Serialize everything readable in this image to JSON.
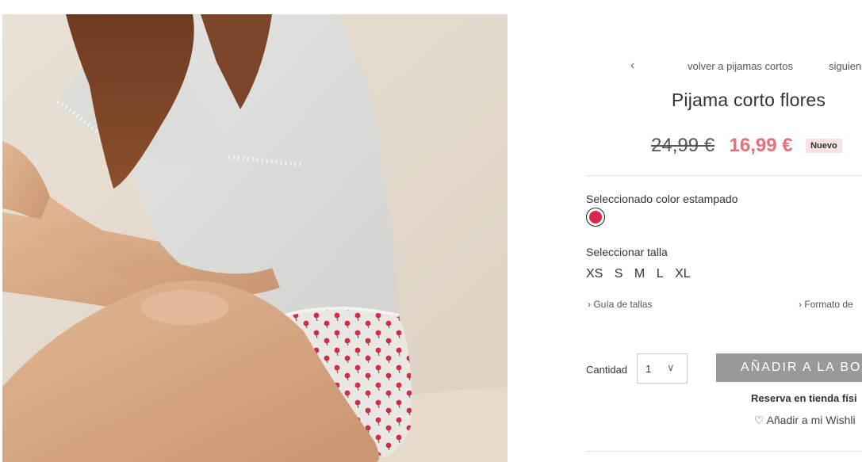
{
  "navigation": {
    "prev_icon": "chevron-left-icon",
    "back_label": "volver a pijamas cortos",
    "next_label": "siguien"
  },
  "product": {
    "title": "Pijama corto flores",
    "old_price": "24,99 €",
    "new_price": "16,99 €",
    "badge": "Nuevo"
  },
  "color": {
    "label": "Seleccionado color estampado",
    "swatch_color": "#d9264a",
    "selected_border": "#222222"
  },
  "sizes": {
    "label": "Seleccionar talla",
    "options": [
      "XS",
      "S",
      "M",
      "L",
      "XL"
    ]
  },
  "links": {
    "size_guide": "Guía de tallas",
    "format": "Formato de"
  },
  "purchase": {
    "quantity_label": "Cantidad",
    "quantity_value": "1",
    "add_button": "AÑADIR A LA BOL",
    "reserve": "Reserva en tienda físi",
    "wishlist": "Añadir a mi Wishli"
  },
  "colors": {
    "accent_price": "#e8707a",
    "badge_bg": "#f7e1e1",
    "button_bg": "#999999"
  }
}
